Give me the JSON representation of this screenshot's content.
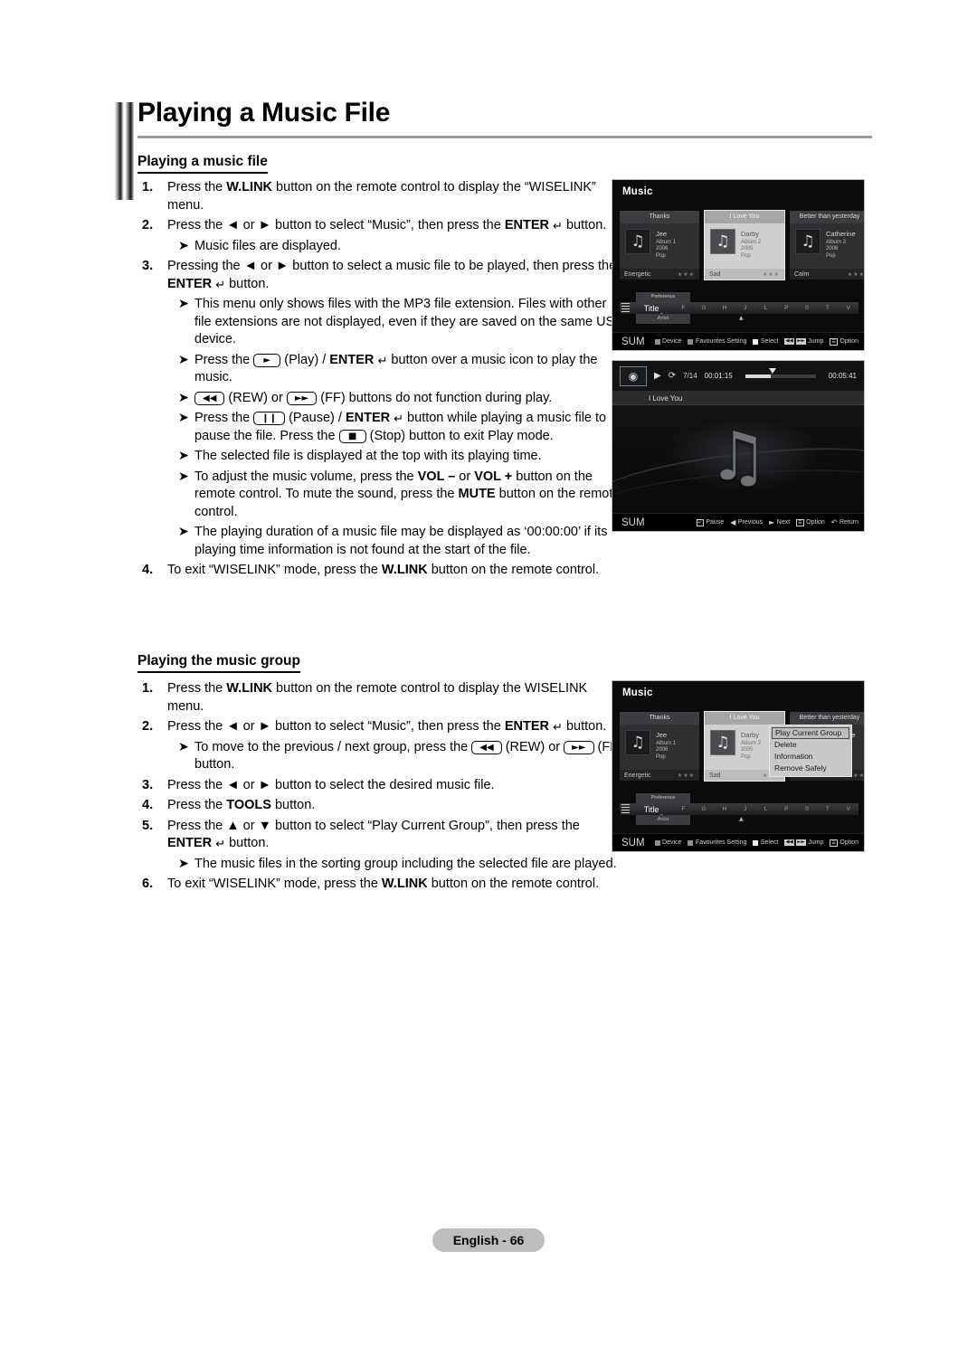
{
  "document": {
    "title": "Playing a Music File",
    "page_footer": "English - 66"
  },
  "section1": {
    "heading": "Playing a music file",
    "steps": [
      {
        "num": "1.",
        "html": "Press the <b>W.LINK</b> button on the remote control to display the “WISELINK” menu."
      },
      {
        "num": "2.",
        "html": "Press the ◄ or ► button to select “Music”, then press the <b>ENTER</b> <span class=\"ent\">↵</span> button."
      }
    ],
    "note_a": "Music files are displayed.",
    "step3": {
      "num": "3.",
      "html": "Pressing the ◄ or ► button to select a music file to be played, then press the <b>ENTER</b> <span class=\"ent\">↵</span> button."
    },
    "notes": [
      "This menu only shows files with the MP3 file extension. Files with other file extensions are not displayed, even if they are saved on the same USB device.",
      "Press the [PLAY] (Play) / ENTER button over a music icon to play the music.",
      "[REW] (REW) or [FF] (FF) buttons do not function during play.",
      "Press the [PAUSE] (Pause) / ENTER button while playing a music file to pause the file. Press the [STOP] (Stop) button to exit Play mode.",
      "The selected file is displayed at the top with its playing time.",
      "To adjust the music volume, press the VOL – or VOL + button on the remote control. To mute the sound, press the MUTE button on the remote control.",
      "The playing duration of a music file may be displayed as ‘00:00:00’ if its playing time information is not found at the start of the file."
    ],
    "step4": {
      "num": "4.",
      "html": "To exit “WISELINK” mode, press the <b>W.LINK</b> button on the remote control."
    }
  },
  "section2": {
    "heading": "Playing the music group",
    "step1": {
      "num": "1.",
      "html": "Press the <b>W.LINK</b> button on the remote control to display the WISELINK menu."
    },
    "step2": {
      "num": "2.",
      "html": "Press the ◄ or ► button to select “Music”, then press the <b>ENTER</b> <span class=\"ent\">↵</span> button."
    },
    "step3": {
      "num": "3.",
      "html": "Press the ◄ or ► button to select the desired music file."
    },
    "step4": {
      "num": "4.",
      "html": "Press the <b>TOOLS</b> button."
    },
    "step5": {
      "num": "5.",
      "html": "Press the ▲ or ▼ button to select “Play Current Group”, then press the <b>ENTER</b> <span class=\"ent\">↵</span> button."
    },
    "step6": {
      "num": "6.",
      "html": "To exit “WISELINK” mode, press the <b>W.LINK</b> button on the remote control."
    },
    "note_group": "To move to the previous / next group, press the (REW) or (FF) button.",
    "note_files": "The music files in the sorting group including the selected file are played."
  },
  "tv_music_browser": {
    "title": "Music",
    "cards": [
      {
        "name": "Thanks",
        "artist": "Jee",
        "album": "Album 1",
        "year": "2006",
        "genre": "Pop",
        "mood": "Energetic",
        "stars": "★★★",
        "selected": false
      },
      {
        "name": "I Love You",
        "artist": "Darby",
        "album": "Album 2",
        "year": "2005",
        "genre": "Pop",
        "mood": "Sad",
        "stars": "★★★",
        "selected": true
      },
      {
        "name": "Better than yesterday",
        "artist": "Catherine",
        "album": "Album 3",
        "year": "2006",
        "genre": "Pop",
        "mood": "Calm",
        "stars": "★★★",
        "selected": false
      }
    ],
    "sort": {
      "tab_above": "Preference",
      "current": "Title",
      "tab_below": "Artist",
      "letters": [
        "F",
        "G",
        "H",
        "J",
        "L",
        "P",
        "S",
        "T",
        "V"
      ]
    },
    "footer": {
      "source": "SUM",
      "items": [
        "Device",
        "Favourites Setting",
        "Select",
        "Jump",
        "Option"
      ]
    }
  },
  "tv_player": {
    "track_index": "7/14",
    "elapsed": "00:01:15",
    "duration": "00:05:41",
    "now_playing": "I Love You",
    "play_glyph": "▶",
    "repeat_glyph": "⟳",
    "note_glyph": "♫",
    "footer": {
      "source": "SUM",
      "items": [
        "Pause",
        "Previous",
        "Next",
        "Option",
        "Return"
      ]
    }
  },
  "tv_tools_menu": {
    "items": [
      "Play Current Group",
      "Delete",
      "Information",
      "Remove Safely"
    ],
    "selected_index": 0
  },
  "colors": {
    "page_bg": "#ffffff",
    "tv_bg": "#0b0b0c",
    "tv_card": "#2d2f31",
    "tv_card_selected": "#cfcfcf",
    "rule": "#9a9a9a",
    "footer_badge": "#bdbdbd"
  }
}
